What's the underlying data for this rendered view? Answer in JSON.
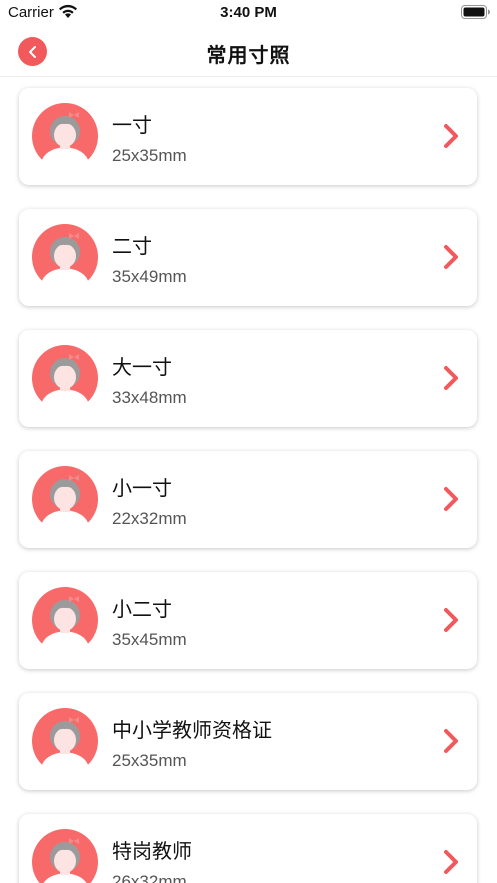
{
  "status_bar": {
    "carrier": "Carrier",
    "time": "3:40 PM"
  },
  "nav": {
    "title": "常用寸照",
    "back_icon": "chevron-left-icon"
  },
  "colors": {
    "accent": "#f2595c",
    "avatar_bg": "#f86a69"
  },
  "items": [
    {
      "title": "一寸",
      "size": "25x35mm"
    },
    {
      "title": "二寸",
      "size": "35x49mm"
    },
    {
      "title": "大一寸",
      "size": "33x48mm"
    },
    {
      "title": "小一寸",
      "size": "22x32mm"
    },
    {
      "title": "小二寸",
      "size": "35x45mm"
    },
    {
      "title": "中小学教师资格证",
      "size": "25x35mm"
    },
    {
      "title": "特岗教师",
      "size": "26x32mm"
    }
  ]
}
